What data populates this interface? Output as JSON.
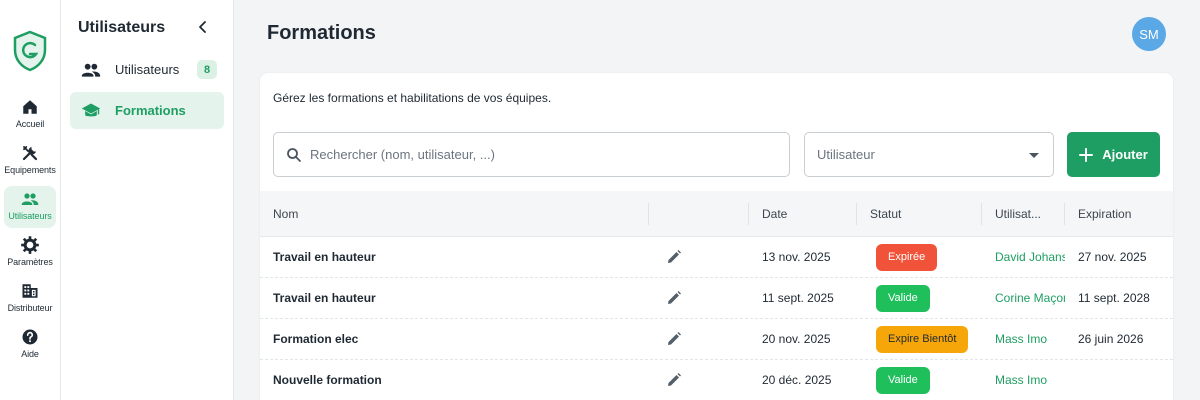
{
  "colors": {
    "accent": "#1e9e62",
    "expired": "#f0533a",
    "valid": "#1fbf5c",
    "soon": "#f6a609",
    "avatar": "#5aa8e6"
  },
  "rail": {
    "items": [
      {
        "label": "Accueil",
        "icon": "home-icon"
      },
      {
        "label": "Equipements",
        "icon": "tools-icon"
      },
      {
        "label": "Utilisateurs",
        "icon": "users-icon",
        "active": true
      },
      {
        "label": "Paramètres",
        "icon": "gear-icon"
      },
      {
        "label": "Distributeur",
        "icon": "building-icon"
      },
      {
        "label": "Aide",
        "icon": "help-icon"
      }
    ]
  },
  "sidebar": {
    "title": "Utilisateurs",
    "items": [
      {
        "label": "Utilisateurs",
        "badge": "8",
        "icon": "users-icon"
      },
      {
        "label": "Formations",
        "icon": "graduation-cap-icon",
        "active": true
      }
    ]
  },
  "header": {
    "title": "Formations",
    "avatar_initials": "SM"
  },
  "main": {
    "subtitle": "Gérez les formations et habilitations de vos équipes.",
    "search_placeholder": "Rechercher (nom, utilisateur, ...)",
    "user_filter": "Utilisateur",
    "add_label": "Ajouter"
  },
  "table": {
    "columns": {
      "name": "Nom",
      "date": "Date",
      "status": "Statut",
      "user": "Utilisat...",
      "expiration": "Expiration"
    },
    "rows": [
      {
        "name": "Travail en hauteur",
        "date": "13 nov. 2025",
        "status": "Expirée",
        "status_kind": "expired",
        "user": "David Johans",
        "expiration": "27 nov. 2025"
      },
      {
        "name": "Travail en hauteur",
        "date": "11 sept. 2025",
        "status": "Valide",
        "status_kind": "valid",
        "user": "Corine Maçon",
        "expiration": "11 sept. 2028"
      },
      {
        "name": "Formation elec",
        "date": "20 nov. 2025",
        "status": "Expire Bientôt",
        "status_kind": "soon",
        "user": "Mass Imo",
        "expiration": "26 juin 2026"
      },
      {
        "name": "Nouvelle formation",
        "date": "20 déc. 2025",
        "status": "Valide",
        "status_kind": "valid",
        "user": "Mass Imo",
        "expiration": ""
      }
    ]
  }
}
